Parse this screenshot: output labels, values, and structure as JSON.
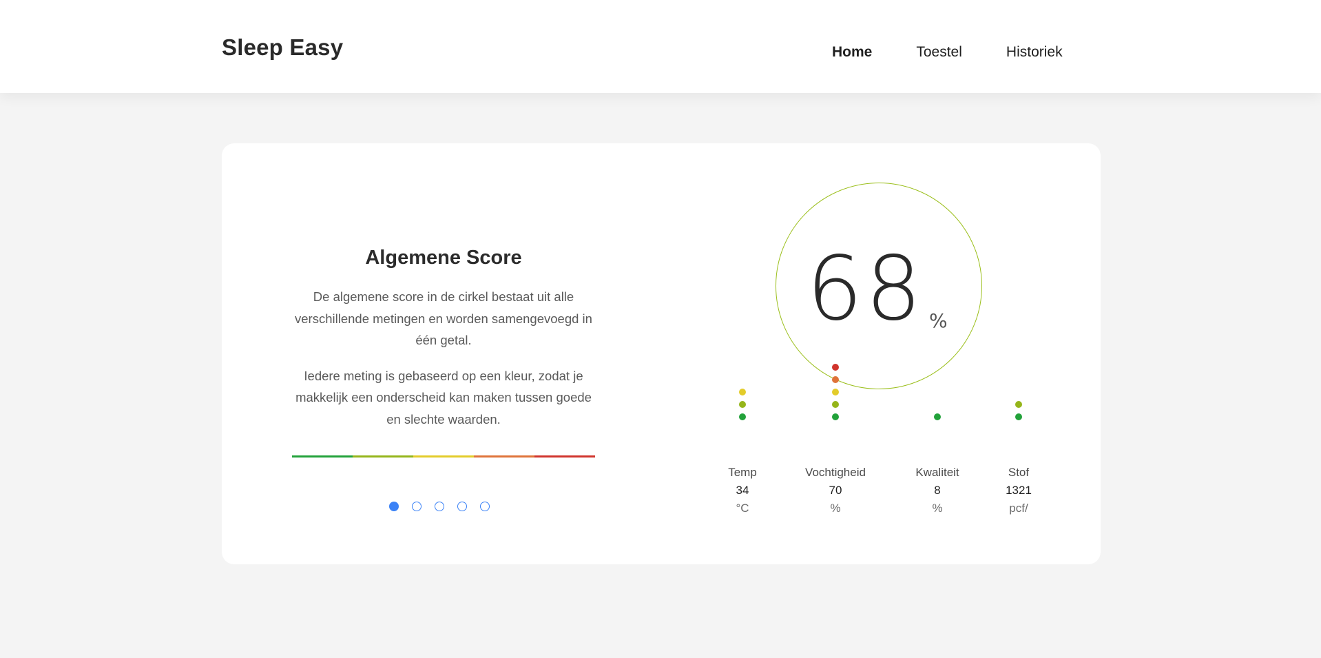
{
  "header": {
    "brand": "Sleep Easy",
    "nav": [
      {
        "label": "Home",
        "active": true
      },
      {
        "label": "Toestel",
        "active": false
      },
      {
        "label": "Historiek",
        "active": false
      }
    ]
  },
  "info": {
    "title": "Algemene Score",
    "paragraph1": "De algemene score in de cirkel bestaat uit alle verschillende metingen en worden samengevoegd in één getal.",
    "paragraph2": "Iedere meting is gebaseerd op een kleur, zodat je makkelijk een onderscheid kan maken tussen goede en slechte waarden.",
    "scale_colors": [
      "#22a23a",
      "#95b51a",
      "#e3cc2a",
      "#df7339",
      "#d0342c"
    ],
    "carousel": {
      "count": 5,
      "active_index": 0
    }
  },
  "score": {
    "value": "68",
    "unit": "%",
    "ring_color": "#9bbf1b"
  },
  "metrics": [
    {
      "label": "Temp",
      "value": "34",
      "unit": "°C",
      "dots": [
        "#22a23a",
        "#95b51a",
        "#e3cc2a"
      ]
    },
    {
      "label": "Vochtigheid",
      "value": "70",
      "unit": "%",
      "dots": [
        "#22a23a",
        "#95b51a",
        "#e3cc2a",
        "#df7339",
        "#d0342c"
      ]
    },
    {
      "label": "Kwaliteit",
      "value": "8",
      "unit": "%",
      "dots": [
        "#22a23a"
      ]
    },
    {
      "label": "Stof",
      "value": "1321",
      "unit": "pcf/",
      "dots": [
        "#22a23a",
        "#95b51a"
      ]
    }
  ]
}
